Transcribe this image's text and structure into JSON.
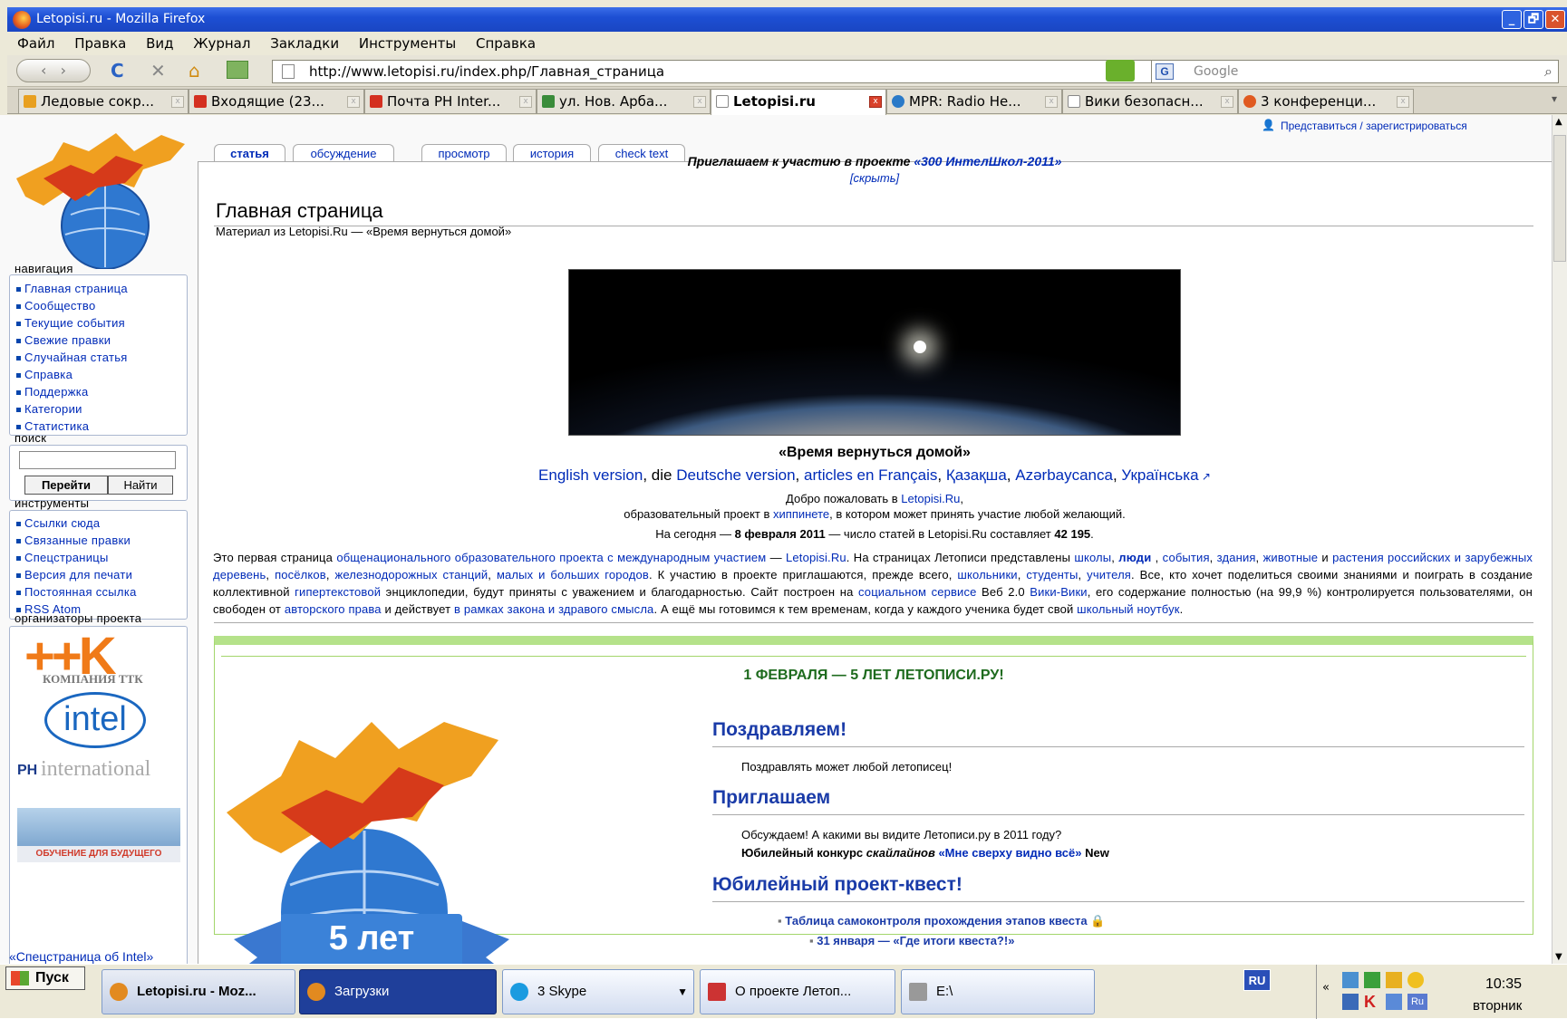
{
  "window": {
    "title": "Letopisi.ru - Mozilla Firefox",
    "btn_min": "_",
    "btn_max": "🗗",
    "btn_close": "✕"
  },
  "menu": [
    "Файл",
    "Правка",
    "Вид",
    "Журнал",
    "Закладки",
    "Инструменты",
    "Справка"
  ],
  "nav": {
    "url": "http://www.letopisi.ru/index.php/Главная_страница",
    "search_placeholder": "Google",
    "back": "‹",
    "fwd": "›",
    "reload": "C",
    "stop": "✕",
    "home": "⌂"
  },
  "tabs": [
    {
      "label": "Ледовые сокр...",
      "color": "#e8a020"
    },
    {
      "label": "Входящие (23...",
      "color": "#d43020"
    },
    {
      "label": "Почта PH Inter...",
      "color": "#d43020"
    },
    {
      "label": "ул. Нов. Арба...",
      "color": "#3a8c3a"
    },
    {
      "label": "Letopisi.ru",
      "color": "#e0e0e0"
    },
    {
      "label": "MPR: Radio He...",
      "color": "#2a7ac8"
    },
    {
      "label": "Вики безопасн...",
      "color": "#e0e0e0"
    },
    {
      "label": "3 конференци...",
      "color": "#e05a20"
    }
  ],
  "page": {
    "login": "Представиться / зарегистрироваться",
    "tabs": [
      "статья",
      "обсуждение",
      "просмотр",
      "история",
      "check text"
    ],
    "notice_text": "Приглашаем к участию в проекте ",
    "notice_link": "«300 ИнтелШкол-2011»",
    "notice_hide": "[скрыть]",
    "title": "Главная страница",
    "subtitle": "Материал из Letopisi.Ru — «Время вернуться домой»",
    "slogan": "«Время вернуться домой»",
    "langs": [
      {
        "text": "English version",
        "link": true
      },
      {
        "text": ", die ",
        "link": false
      },
      {
        "text": "Deutsche version",
        "link": true
      },
      {
        "text": ", ",
        "link": false
      },
      {
        "text": "articles en Français",
        "link": true
      },
      {
        "text": ", ",
        "link": false
      },
      {
        "text": "Қазақша",
        "link": true
      },
      {
        "text": ", ",
        "link": false
      },
      {
        "text": "Azərbaycanca",
        "link": true
      },
      {
        "text": ", ",
        "link": false
      },
      {
        "text": "Українська",
        "link": true
      }
    ],
    "welcome1_pre": "Добро пожаловать в ",
    "welcome1_link": "Letopisi.Ru",
    "welcome1_post": ",",
    "welcome2_pre": "образовательный проект в ",
    "welcome2_link": "хиппинете",
    "welcome2_post": ", в котором может принять участие любой желающий.",
    "today_pre": "На сегодня — ",
    "today_date": "8 февраля 2011",
    "today_mid": " — число статей в Letopisi.Ru составляет ",
    "today_count": "42 195",
    "today_post": "."
  },
  "sidebar": {
    "nav_title": "навигация",
    "nav": [
      "Главная страница",
      "Сообщество",
      "Текущие события",
      "Свежие правки",
      "Случайная статья",
      "Справка",
      "Поддержка",
      "Категории",
      "Статистика"
    ],
    "search_title": "поиск",
    "go": "Перейти",
    "find": "Найти",
    "tools_title": "инструменты",
    "tools": [
      "Ссылки сюда",
      "Связанные правки",
      "Спецстраницы",
      "Версия для печати",
      "Постоянная ссылка",
      "RSS Atom"
    ],
    "org_title": "организаторы проекта",
    "ttk_logo": "++K",
    "ttk_caption": "КОМПАНИЯ ТТК",
    "intel": "intel",
    "phint_ph": "PH",
    "phint": "international",
    "edu": "ОБУЧЕНИЕ ДЛЯ БУДУЩЕГО",
    "bottom_link": "«Спецстраница об Intel»"
  },
  "anniv": {
    "header": "1 ФЕВРАЛЯ — 5 ЛЕТ ЛЕТОПИСИ.РУ!",
    "ribbon": "5 лет",
    "congrats_h": "Поздравляем!",
    "congrats_t": "Поздравлять может любой летописец!",
    "invite_h": "Приглашаем",
    "invite_t": "Обсуждаем! А какими вы видите Летописи.ру в 2011 году?",
    "contest_pre": "Юбилейный конкурс ",
    "contest_em": "скайлайнов",
    "contest_link": " «Мне сверху видно всё»",
    "contest_new": " New",
    "quest_h": "Юбилейный проект-квест!",
    "quest_1": "Таблица самоконтроля прохождения этапов квеста",
    "quest_2": "31 января — «Где итоги квеста?!»"
  },
  "taskbar": {
    "start": "Пуск",
    "lang": "RU",
    "clock": "10:35",
    "day": "вторник",
    "tasks": [
      "Letopisi.ru - Moz...",
      "Загрузки",
      "3 Skype",
      "О проекте Летоп...",
      "E:\\"
    ]
  }
}
